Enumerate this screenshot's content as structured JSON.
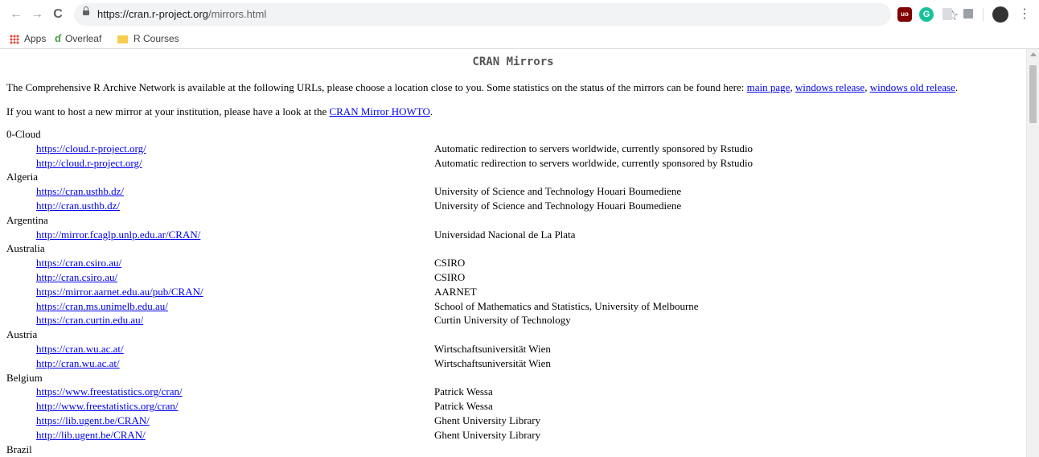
{
  "browser": {
    "url_host": "https://cran.r-project.org",
    "url_path": "/mirrors.html",
    "back_glyph": "←",
    "forward_glyph": "→",
    "reload_glyph": "C",
    "star_glyph": "☆",
    "menu_glyph": "⋮",
    "ublock_text": "uo",
    "grammarly_text": "G",
    "bookmarks": [
      {
        "label": "Apps"
      },
      {
        "label": "Overleaf"
      },
      {
        "label": "R Courses"
      }
    ]
  },
  "page": {
    "title": "CRAN Mirrors",
    "intro_text": "The Comprehensive R Archive Network is available at the following URLs, please choose a location close to you. Some statistics on the status of the mirrors can be found here: ",
    "intro_links": [
      "main page",
      "windows release",
      "windows old release"
    ],
    "intro_sep1": ", ",
    "intro_sep2": ", ",
    "intro_end": ".",
    "host_text": "If you want to host a new mirror at your institution, please have a look at the ",
    "host_link": "CRAN Mirror HOWTO",
    "host_end": "."
  },
  "mirrors": [
    {
      "type": "country",
      "name": "0-Cloud"
    },
    {
      "type": "mirror",
      "url": "https://cloud.r-project.org/",
      "desc": "Automatic redirection to servers worldwide, currently sponsored by Rstudio"
    },
    {
      "type": "mirror",
      "url": "http://cloud.r-project.org/",
      "desc": "Automatic redirection to servers worldwide, currently sponsored by Rstudio"
    },
    {
      "type": "country",
      "name": "Algeria"
    },
    {
      "type": "mirror",
      "url": "https://cran.usthb.dz/",
      "desc": "University of Science and Technology Houari Boumediene"
    },
    {
      "type": "mirror",
      "url": "http://cran.usthb.dz/",
      "desc": "University of Science and Technology Houari Boumediene"
    },
    {
      "type": "country",
      "name": "Argentina"
    },
    {
      "type": "mirror",
      "url": "http://mirror.fcaglp.unlp.edu.ar/CRAN/",
      "desc": "Universidad Nacional de La Plata"
    },
    {
      "type": "country",
      "name": "Australia"
    },
    {
      "type": "mirror",
      "url": "https://cran.csiro.au/",
      "desc": "CSIRO"
    },
    {
      "type": "mirror",
      "url": "http://cran.csiro.au/",
      "desc": "CSIRO"
    },
    {
      "type": "mirror",
      "url": "https://mirror.aarnet.edu.au/pub/CRAN/",
      "desc": "AARNET"
    },
    {
      "type": "mirror",
      "url": "https://cran.ms.unimelb.edu.au/",
      "desc": "School of Mathematics and Statistics, University of Melbourne"
    },
    {
      "type": "mirror",
      "url": "https://cran.curtin.edu.au/",
      "desc": "Curtin University of Technology"
    },
    {
      "type": "country",
      "name": "Austria"
    },
    {
      "type": "mirror",
      "url": "https://cran.wu.ac.at/",
      "desc": "Wirtschaftsuniversität Wien"
    },
    {
      "type": "mirror",
      "url": "http://cran.wu.ac.at/",
      "desc": "Wirtschaftsuniversität Wien"
    },
    {
      "type": "country",
      "name": "Belgium"
    },
    {
      "type": "mirror",
      "url": "https://www.freestatistics.org/cran/",
      "desc": "Patrick Wessa"
    },
    {
      "type": "mirror",
      "url": "http://www.freestatistics.org/cran/",
      "desc": "Patrick Wessa"
    },
    {
      "type": "mirror",
      "url": "https://lib.ugent.be/CRAN/",
      "desc": "Ghent University Library"
    },
    {
      "type": "mirror",
      "url": "http://lib.ugent.be/CRAN/",
      "desc": "Ghent University Library"
    },
    {
      "type": "country",
      "name": "Brazil"
    }
  ]
}
